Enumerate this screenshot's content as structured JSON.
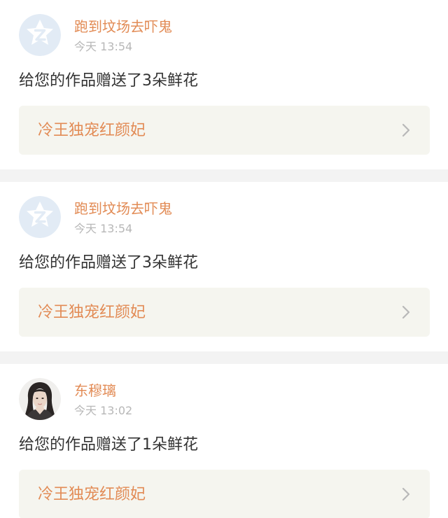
{
  "notifications": [
    {
      "username": "跑到坟场去吓鬼",
      "time": "今天 13:54",
      "message": "给您的作品赠送了3朵鲜花",
      "work_title": "冷王独宠红颜妃",
      "avatar": "default-z-avatar-icon"
    },
    {
      "username": "跑到坟场去吓鬼",
      "time": "今天 13:54",
      "message": "给您的作品赠送了3朵鲜花",
      "work_title": "冷王独宠红颜妃",
      "avatar": "default-z-avatar-icon"
    },
    {
      "username": "东穆璃",
      "time": "今天 13:02",
      "message": "给您的作品赠送了1朵鲜花",
      "work_title": "冷王独宠红颜妃",
      "avatar": "user-photo-avatar"
    }
  ],
  "colors": {
    "accent": "#e28b55",
    "time": "#b7b7b7",
    "text": "#333333",
    "link_background": "#f5f5ef",
    "divider": "#f3f3f3",
    "default_avatar": "#e2ebf5"
  }
}
